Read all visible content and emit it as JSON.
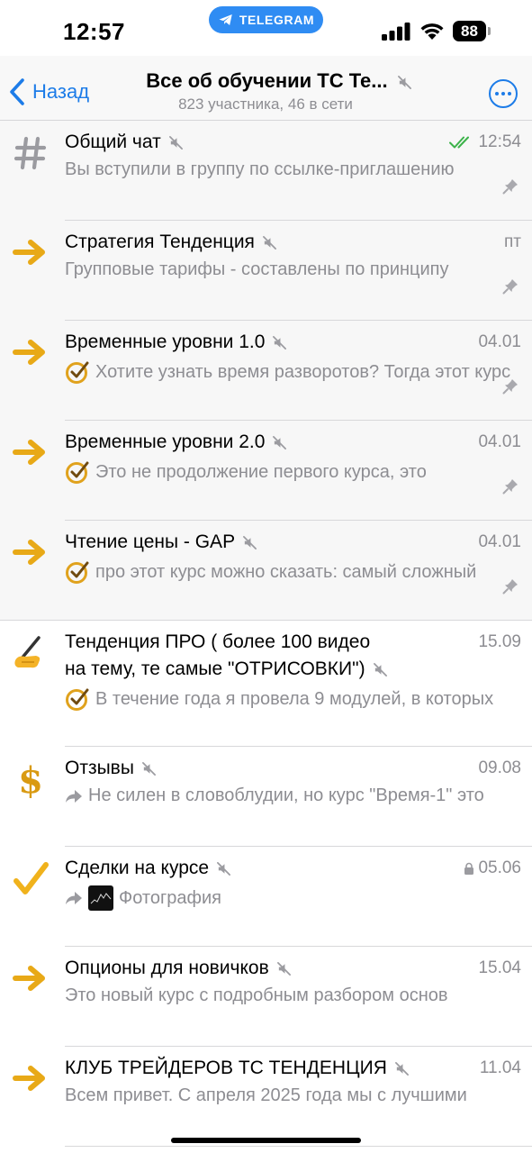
{
  "status_bar": {
    "time": "12:57",
    "telegram_pill": "TELEGRAM",
    "battery": "88"
  },
  "nav": {
    "back_label": "Назад",
    "title": "Все об обучении ТС Те...",
    "subtitle": "823 участника, 46 в сети"
  },
  "topics": [
    {
      "title": "Общий чат",
      "date": "12:54",
      "preview": "Вы вступили в группу по ссылке-приглашению",
      "icon": "hashtag-icon",
      "pinned": true,
      "read": true
    },
    {
      "title": "Стратегия Тенденция",
      "date": "пт",
      "preview": "Групповые тарифы - составлены по принципу",
      "icon": "arrow-right-icon",
      "pinned": true
    },
    {
      "title": "Временные уровни 1.0",
      "date": "04.01",
      "preview": "Хотите узнать время разворотов?  Тогда этот курс",
      "icon": "arrow-right-icon",
      "pinned": true
    },
    {
      "title": "Временные уровни 2.0",
      "date": "04.01",
      "preview": "Это не продолжение первого курса, это",
      "icon": "arrow-right-icon",
      "pinned": true
    },
    {
      "title": "Чтение цены - GAP",
      "date": "04.01",
      "preview": "про этот курс можно сказать: самый сложный",
      "icon": "arrow-right-icon",
      "pinned": true
    },
    {
      "title": "Тенденция ПРО ( более 100 видео",
      "title_line2": "на тему, те самые \"ОТРИСОВКИ\")",
      "date": "15.09",
      "preview": "В течение года я провела 9 модулей, в которых",
      "icon": "writing-hand-icon"
    },
    {
      "title": "Отзывы",
      "date": "09.08",
      "preview": "Не силен в словоблудии, но курс \"Время-1\" это",
      "icon": "dollar-icon"
    },
    {
      "title": "Сделки на курсе",
      "date": "05.06",
      "preview": "Фотография",
      "icon": "check-mark-icon"
    },
    {
      "title": "Опционы для новичков",
      "date": "15.04",
      "preview": "Это новый курс с подробным разбором основ",
      "icon": "arrow-right-icon"
    },
    {
      "title": "КЛУБ ТРЕЙДЕРОВ ТС ТЕНДЕНЦИЯ",
      "date": "11.04",
      "preview": "Всем привет.  С апреля 2025 года мы с лучшими",
      "icon": "arrow-right-icon"
    }
  ]
}
